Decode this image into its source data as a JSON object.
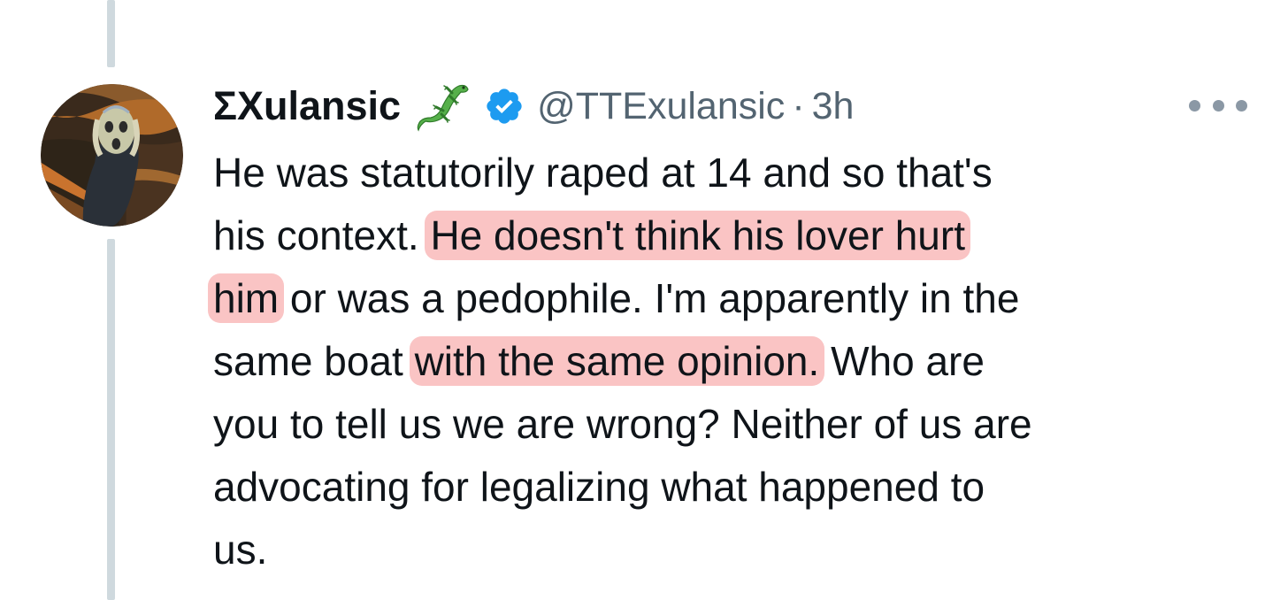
{
  "tweet": {
    "author": {
      "display_name": "ΣΧulansic",
      "emoji_icon": "lizard-icon",
      "verified_icon": "verified-badge-icon",
      "handle": "@TTExulansic",
      "separator": "·",
      "timestamp": "3h",
      "avatar_icon": "the-scream-painting-avatar"
    },
    "more_icon": "more-options-icon",
    "body_lines": [
      {
        "parts": [
          {
            "text": "He was statutorily raped at 14 and so that's",
            "highlight": false
          }
        ]
      },
      {
        "parts": [
          {
            "text": "his context. ",
            "highlight": false
          },
          {
            "text": "He doesn't think his lover hurt",
            "highlight": true
          }
        ]
      },
      {
        "parts": [
          {
            "text": "him",
            "highlight": true
          },
          {
            "text": " or was a pedophile. I'm apparently in the",
            "highlight": false
          }
        ]
      },
      {
        "parts": [
          {
            "text": "same boat ",
            "highlight": false
          },
          {
            "text": "with the same opinion.",
            "highlight": true
          },
          {
            "text": " Who are",
            "highlight": false
          }
        ]
      },
      {
        "parts": [
          {
            "text": "you to tell us we are wrong? Neither of us are",
            "highlight": false
          }
        ]
      },
      {
        "parts": [
          {
            "text": "advocating for legalizing what happened to",
            "highlight": false
          }
        ]
      },
      {
        "parts": [
          {
            "text": "us.",
            "highlight": false
          }
        ]
      }
    ]
  },
  "colors": {
    "text_primary": "#0f1419",
    "text_secondary": "#536471",
    "verified_blue": "#1d9bf0",
    "thread_line": "#cfd9de",
    "highlight": "#f7a0a0"
  }
}
